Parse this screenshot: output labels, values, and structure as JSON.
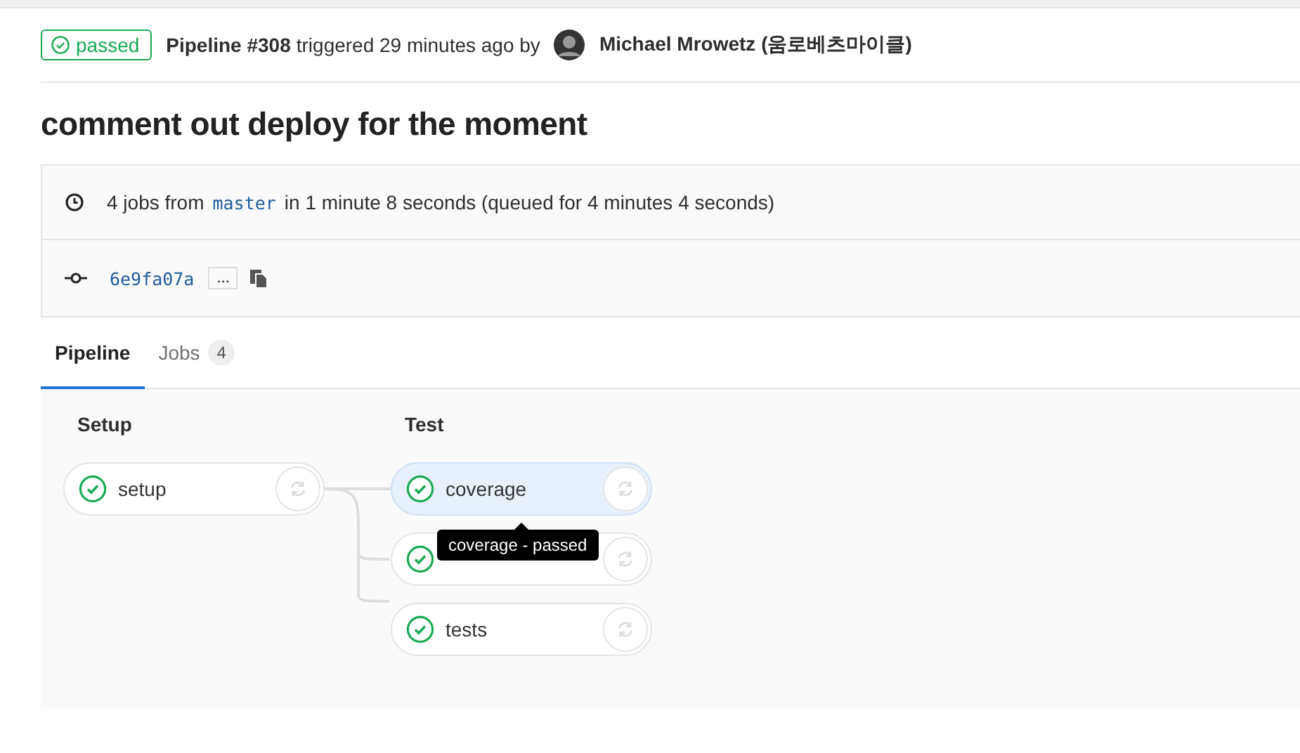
{
  "header": {
    "status": {
      "label": "passed",
      "kind": "success"
    },
    "pipeline": "Pipeline #308",
    "triggered": "triggered 29 minutes ago by",
    "author": "Michael Mrowetz (움로베츠마이클)"
  },
  "title": "comment out deploy for the moment",
  "info": {
    "jobs_prefix": "4 jobs from",
    "branch": "master",
    "duration": "in 1 minute 8 seconds (queued for 4 minutes 4 seconds)",
    "commit": "6e9fa07a",
    "expand": "..."
  },
  "tabs": [
    {
      "label": "Pipeline",
      "selected": true
    },
    {
      "label": "Jobs",
      "count": "4",
      "selected": false
    }
  ],
  "stages": [
    {
      "name": "Setup",
      "jobs": [
        {
          "name": "setup",
          "passed": true,
          "selected": false
        }
      ]
    },
    {
      "name": "Test",
      "jobs": [
        {
          "name": "coverage",
          "passed": true,
          "selected": true
        },
        {
          "passed": true,
          "selected": false
        },
        {
          "name": "tests",
          "passed": true,
          "selected": false
        }
      ]
    }
  ],
  "tooltip": "coverage - passed"
}
